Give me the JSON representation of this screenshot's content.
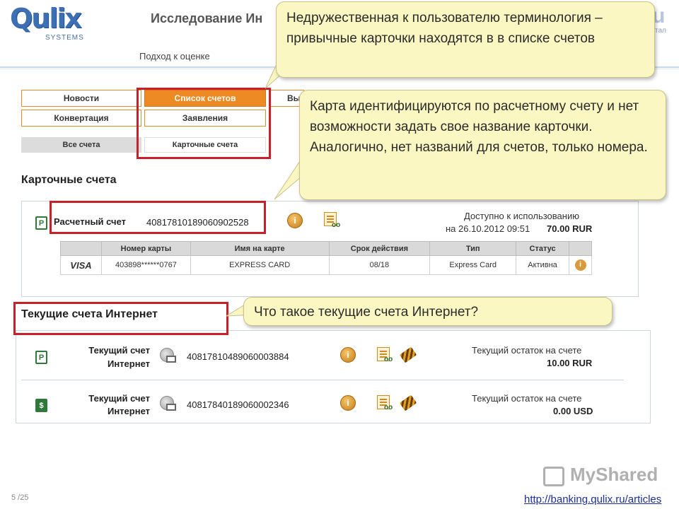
{
  "slide": {
    "logo_text": "Qulix",
    "logo_sub": "SYSTEMS",
    "title": "Исследование Ин",
    "logo_right": "u",
    "logo_right_sub": "тал",
    "subtitle": "Подход к оценке",
    "page_number": "5 /25",
    "watermark": "MyShared",
    "link": "http://banking.qulix.ru/articles"
  },
  "tabs": {
    "row1": [
      "Новости",
      "Список счетов",
      "Вы"
    ],
    "row2": [
      "Конвертация",
      "Заявления"
    ],
    "subtabs": [
      "Все счета",
      "Карточные счета"
    ]
  },
  "card_accounts": {
    "title": "Карточные счета",
    "icon_symbol": "Р",
    "account_label": "Расчетный счет",
    "account_number": "40817810189060902528",
    "available_label": "Доступно к использованию",
    "available_date": "на 26.10.2012 09:51",
    "available_amount": "70.00 RUR",
    "table_headers": [
      "",
      "Номер карты",
      "Имя на карте",
      "Срок действия",
      "Тип",
      "Статус",
      ""
    ],
    "rows": [
      {
        "brand": "VISA",
        "number": "403898******0767",
        "name": "EXPRESS CARD",
        "expiry": "08/18",
        "type": "Express Card",
        "status": "Активна"
      }
    ]
  },
  "internet_accounts": {
    "title": "Текущие счета Интернет",
    "items": [
      {
        "icon_symbol": "Р",
        "label_line1": "Текущий счет",
        "label_line2": "Интернет",
        "number": "40817810489060003884",
        "balance_label": "Текущий остаток на счете",
        "balance": "10.00 RUR"
      },
      {
        "icon_symbol": "$",
        "label_line1": "Текущий счет",
        "label_line2": "Интернет",
        "number": "40817840189060002346",
        "balance_label": "Текущий остаток на счете",
        "balance": "0.00 USD"
      }
    ]
  },
  "callouts": {
    "c1": "Недружественная к пользователю терминология – привычные карточки находятся в в списке счетов",
    "c2": "Карта идентифицируются по расчетному счету и нет возможности задать свое название карточки. Аналогично, нет названий для счетов, только номера.",
    "c3": "Что такое текущие счета Интернет?"
  },
  "colors": {
    "accent_orange": "#ee8a24",
    "highlight_red": "#c8202a",
    "callout_bg": "#fbf7c2",
    "status_green": "#2b8a2b",
    "link_blue": "#1a2f9a"
  }
}
